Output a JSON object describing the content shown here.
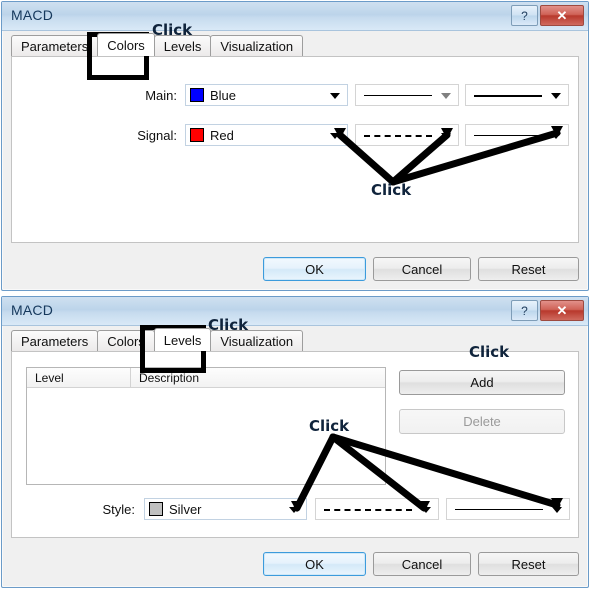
{
  "dialogs": [
    {
      "title": "MACD",
      "help_label": "?",
      "close_label": "✕",
      "tabs": [
        {
          "label": "Parameters",
          "active": false
        },
        {
          "label": "Colors",
          "active": true
        },
        {
          "label": "Levels",
          "active": false
        },
        {
          "label": "Visualization",
          "active": false
        }
      ],
      "highlighted_tab": "Colors",
      "rows": [
        {
          "label": "Main:",
          "color_name": "Blue",
          "color_hex": "#0000FF",
          "style_preview": "solid-thin",
          "width_preview": "solid-thick"
        },
        {
          "label": "Signal:",
          "color_name": "Red",
          "color_hex": "#FF0000",
          "style_preview": "dashed",
          "width_preview": "solid-thin"
        }
      ],
      "buttons": [
        {
          "label": "OK",
          "state": "default"
        },
        {
          "label": "Cancel",
          "state": "normal"
        },
        {
          "label": "Reset",
          "state": "normal"
        }
      ],
      "annotations": [
        {
          "label": "Click",
          "target": "tab-colors"
        },
        {
          "label": "Click",
          "target": "color-style-width-dropdowns"
        }
      ]
    },
    {
      "title": "MACD",
      "help_label": "?",
      "close_label": "✕",
      "tabs": [
        {
          "label": "Parameters",
          "active": false
        },
        {
          "label": "Colors",
          "active": false
        },
        {
          "label": "Levels",
          "active": true
        },
        {
          "label": "Visualization",
          "active": false
        }
      ],
      "highlighted_tab": "Levels",
      "list": {
        "columns": [
          "Level",
          "Description"
        ],
        "rows": []
      },
      "side_buttons": [
        {
          "label": "Add",
          "state": "normal"
        },
        {
          "label": "Delete",
          "state": "disabled"
        }
      ],
      "style_row": {
        "label": "Style:",
        "color_name": "Silver",
        "color_hex": "#C0C0C0",
        "style_preview": "dashed",
        "width_preview": "solid-thin"
      },
      "buttons": [
        {
          "label": "OK",
          "state": "default"
        },
        {
          "label": "Cancel",
          "state": "normal"
        },
        {
          "label": "Reset",
          "state": "normal"
        }
      ],
      "annotations": [
        {
          "label": "Click",
          "target": "tab-levels"
        },
        {
          "label": "Click",
          "target": "add-button"
        },
        {
          "label": "Click",
          "target": "style-dropdowns"
        }
      ]
    }
  ]
}
